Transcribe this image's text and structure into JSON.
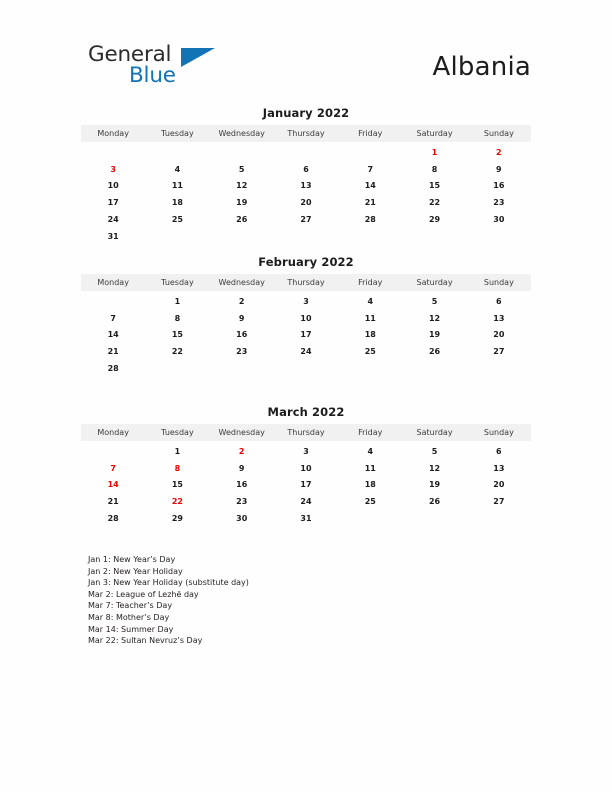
{
  "header": {
    "logo": {
      "word_top": "General",
      "word_bottom": "Blue",
      "triangle_icon": "blue-triangle-logo-mark",
      "color_dark": "#2b2b2b",
      "color_blue": "#1273b5"
    },
    "country": "Albania"
  },
  "theme": {
    "holiday_color": "#ec0000",
    "text_color": "#1c1c1c",
    "header_row_bg": "#f1f1f1",
    "page_bg": "#fefefe"
  },
  "weekday_headers": [
    "Monday",
    "Tuesday",
    "Wednesday",
    "Thursday",
    "Friday",
    "Saturday",
    "Sunday"
  ],
  "months": [
    {
      "title": "January 2022",
      "name": "January",
      "year": 2022,
      "weeks": [
        [
          "",
          "",
          "",
          "",
          "",
          "1",
          "2"
        ],
        [
          "3",
          "4",
          "5",
          "6",
          "7",
          "8",
          "9"
        ],
        [
          "10",
          "11",
          "12",
          "13",
          "14",
          "15",
          "16"
        ],
        [
          "17",
          "18",
          "19",
          "20",
          "21",
          "22",
          "23"
        ],
        [
          "24",
          "25",
          "26",
          "27",
          "28",
          "29",
          "30"
        ],
        [
          "31",
          "",
          "",
          "",
          "",
          "",
          ""
        ]
      ],
      "holidays": [
        1,
        2,
        3
      ]
    },
    {
      "title": "February 2022",
      "name": "February",
      "year": 2022,
      "weeks": [
        [
          "",
          "1",
          "2",
          "3",
          "4",
          "5",
          "6"
        ],
        [
          "7",
          "8",
          "9",
          "10",
          "11",
          "12",
          "13"
        ],
        [
          "14",
          "15",
          "16",
          "17",
          "18",
          "19",
          "20"
        ],
        [
          "21",
          "22",
          "23",
          "24",
          "25",
          "26",
          "27"
        ],
        [
          "28",
          "",
          "",
          "",
          "",
          "",
          ""
        ]
      ],
      "holidays": []
    },
    {
      "title": "March 2022",
      "name": "March",
      "year": 2022,
      "weeks": [
        [
          "",
          "1",
          "2",
          "3",
          "4",
          "5",
          "6"
        ],
        [
          "7",
          "8",
          "9",
          "10",
          "11",
          "12",
          "13"
        ],
        [
          "14",
          "15",
          "16",
          "17",
          "18",
          "19",
          "20"
        ],
        [
          "21",
          "22",
          "23",
          "24",
          "25",
          "26",
          "27"
        ],
        [
          "28",
          "29",
          "30",
          "31",
          "",
          "",
          ""
        ]
      ],
      "holidays": [
        2,
        7,
        8,
        14,
        22
      ]
    }
  ],
  "holiday_list": [
    "Jan 1: New Year’s Day",
    "Jan 2: New Year Holiday",
    "Jan 3: New Year Holiday (substitute day)",
    "Mar 2: League of Lezhë day",
    "Mar 7: Teacher’s Day",
    "Mar 8: Mother’s Day",
    "Mar 14: Summer Day",
    "Mar 22: Sultan Nevruz’s Day"
  ]
}
